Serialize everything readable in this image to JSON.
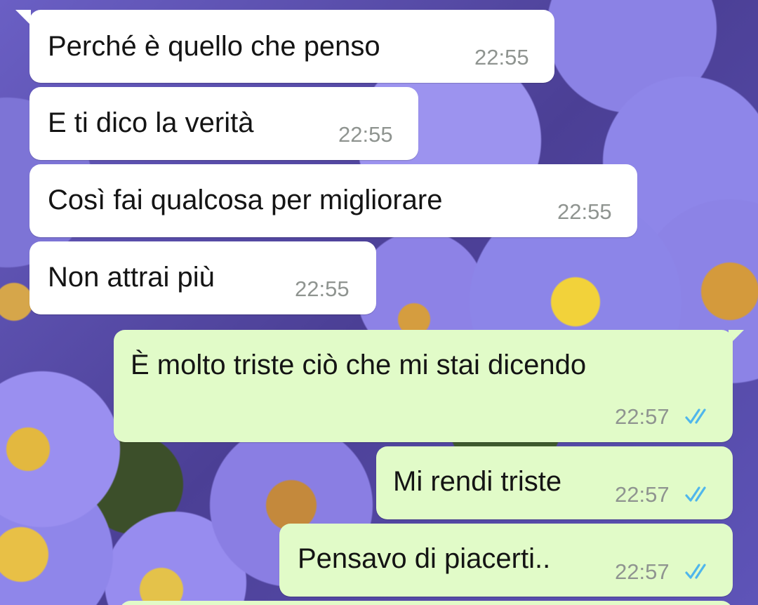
{
  "conversation": {
    "messages": [
      {
        "direction": "incoming",
        "text": "Perché è quello che penso",
        "time": "22:55"
      },
      {
        "direction": "incoming",
        "text": "E ti dico la verità",
        "time": "22:55"
      },
      {
        "direction": "incoming",
        "text": "Così fai qualcosa per migliorare",
        "time": "22:55"
      },
      {
        "direction": "incoming",
        "text": "Non attrai più",
        "time": "22:55"
      },
      {
        "direction": "outgoing",
        "text": "È molto triste ciò che mi stai dicendo",
        "time": "22:57",
        "status_icon": "double-check-read-icon"
      },
      {
        "direction": "outgoing",
        "text": "Mi rendi triste",
        "time": "22:57",
        "status_icon": "double-check-read-icon"
      },
      {
        "direction": "outgoing",
        "text": "Pensavo di piacerti..",
        "time": "22:57",
        "status_icon": "double-check-read-icon"
      }
    ]
  },
  "colors": {
    "incoming_bubble": "#ffffff",
    "outgoing_bubble": "#e1fbc8",
    "read_tick": "#4fb6ec",
    "timestamp": "#8f9490"
  }
}
